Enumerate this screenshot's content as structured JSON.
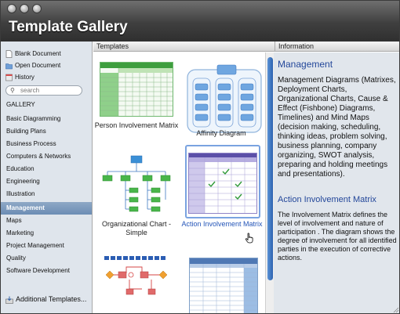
{
  "window": {
    "title": "Template Gallery"
  },
  "headers": {
    "templates": "Templates",
    "information": "Information"
  },
  "sidebar": {
    "top_items": [
      {
        "label": "Blank Document",
        "icon": "blank-document-icon"
      },
      {
        "label": "Open Document",
        "icon": "open-folder-icon"
      },
      {
        "label": "History",
        "icon": "history-icon"
      }
    ],
    "search": {
      "placeholder": "search",
      "value": ""
    },
    "gallery_heading": "GALLERY",
    "categories": [
      "Basic Diagramming",
      "Building Plans",
      "Business Process",
      "Computers & Networks",
      "Education",
      "Engineering",
      "Illustration",
      "Management",
      "Maps",
      "Marketing",
      "Project Management",
      "Quality",
      "Software Development"
    ],
    "selected_category": "Management",
    "additional_templates": "Additional Templates..."
  },
  "templates": [
    {
      "label": "Person Involvement Matrix",
      "thumb": "green-matrix",
      "selected": false
    },
    {
      "label": "Affinity Diagram",
      "thumb": "affinity-diagram",
      "selected": false
    },
    {
      "label": "Organizational Chart - Simple",
      "thumb": "org-chart",
      "selected": false
    },
    {
      "label": "Action Involvement Matrix",
      "thumb": "purple-check-matrix",
      "selected": true
    },
    {
      "label": "",
      "thumb": "process-flow",
      "selected": false
    },
    {
      "label": "",
      "thumb": "blue-table",
      "selected": false
    }
  ],
  "info": {
    "title": "Management",
    "description": "Management Diagrams (Matrixes, Deployment Charts, Organizational Charts, Cause & Effect (Fishbone) Diagrams, Timelines) and Mind Maps (decision making, scheduling, thinking ideas, problem solving, business planning, company organizing, SWOT analysis, preparing and holding meetings and presentations).",
    "item_title": "Action Involvement Matrix",
    "item_description": "The Involvement Matrix defines the level of involvement and nature of participation . The diagram shows the degree of involvement for all identified parties in the execution of corrective actions."
  },
  "colors": {
    "selection": "#6c8db4",
    "info_title": "#23479a",
    "scroll_thumb": "#2c63b0",
    "matrix_green": "#5db85d",
    "matrix_purple": "#7e6fb8"
  }
}
